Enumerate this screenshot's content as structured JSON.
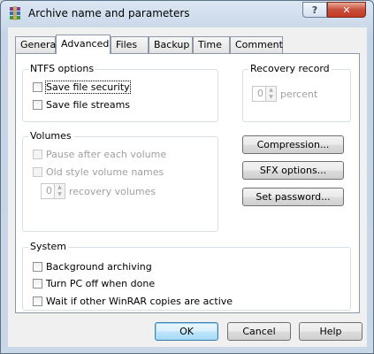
{
  "window": {
    "title": "Archive name and parameters",
    "help_glyph": "?",
    "close_glyph": "✕"
  },
  "tabs": [
    {
      "label": "General"
    },
    {
      "label": "Advanced",
      "active": true
    },
    {
      "label": "Files"
    },
    {
      "label": "Backup"
    },
    {
      "label": "Time"
    },
    {
      "label": "Comment"
    }
  ],
  "ntfs": {
    "label": "NTFS options",
    "save_security": "Save file security",
    "save_streams": "Save file streams"
  },
  "recovery": {
    "label": "Recovery record",
    "value": "0",
    "unit": "percent"
  },
  "volumes": {
    "label": "Volumes",
    "pause": "Pause after each volume",
    "old_style": "Old style volume names",
    "value": "0",
    "unit": "recovery volumes"
  },
  "buttons": {
    "compression": "Compression...",
    "sfx": "SFX options...",
    "password": "Set password...",
    "ok": "OK",
    "cancel": "Cancel",
    "help": "Help"
  },
  "system": {
    "label": "System",
    "background": "Background archiving",
    "turn_off": "Turn PC off when done",
    "wait": "Wait if other WinRAR copies are active"
  },
  "colors": {
    "title_bg": "#cfd9e6",
    "close_red": "#c84e3b",
    "default_btn_border": "#3c7fb1"
  }
}
